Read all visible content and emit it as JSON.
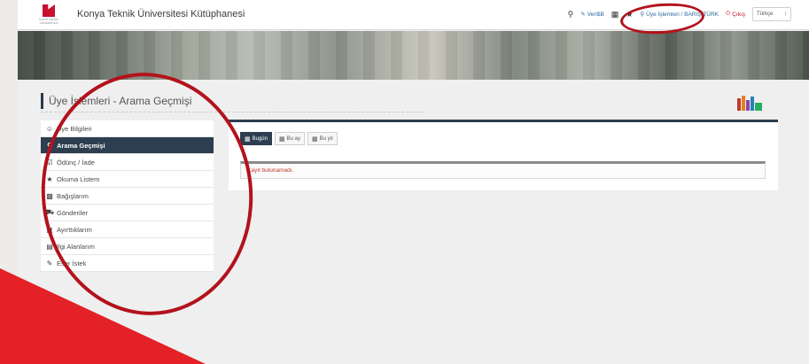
{
  "header": {
    "logo_text": "KONYA TEKNİK ÜNİVERSİTESİ",
    "title": "Konya Teknik Üniversitesi Kütüphanesi",
    "toolbar": {
      "search_icon": "search-icon",
      "eresources_label": "Veri$B",
      "member_ops_label": "Üye İşlemleri / BARIŞ TÜRK",
      "logout_label": "Çıkış",
      "language_value": "Türkçe"
    }
  },
  "page": {
    "heading": "Üye İşlemleri - Arama Geçmişi"
  },
  "sidebar": {
    "items": [
      {
        "label": "Üye Bilgileri",
        "icon": "user-icon"
      },
      {
        "label": "Arama Geçmişi",
        "icon": "search-icon",
        "active": true
      },
      {
        "label": "Ödünç / İade",
        "icon": "calendar-check-icon"
      },
      {
        "label": "Okuma Listem",
        "icon": "star-icon"
      },
      {
        "label": "Bağışlarım",
        "icon": "gift-icon"
      },
      {
        "label": "Gönderiler",
        "icon": "truck-icon"
      },
      {
        "label": "Ayırttıklarım",
        "icon": "inbox-icon"
      },
      {
        "label": "İlgi Alanlarım",
        "icon": "list-icon"
      },
      {
        "label": "Eser İstek",
        "icon": "edit-icon"
      }
    ]
  },
  "history": {
    "tabs": [
      {
        "label": "Bugün",
        "active": true
      },
      {
        "label": "Bu ay"
      },
      {
        "label": "Bu yıl"
      }
    ],
    "empty_message": "Kayıt bulunamadı."
  },
  "colors": {
    "nav_dark": "#2c3e50",
    "annotation_red": "#b3121c",
    "triangle_red": "#e32127",
    "error_text": "#c0392b"
  }
}
